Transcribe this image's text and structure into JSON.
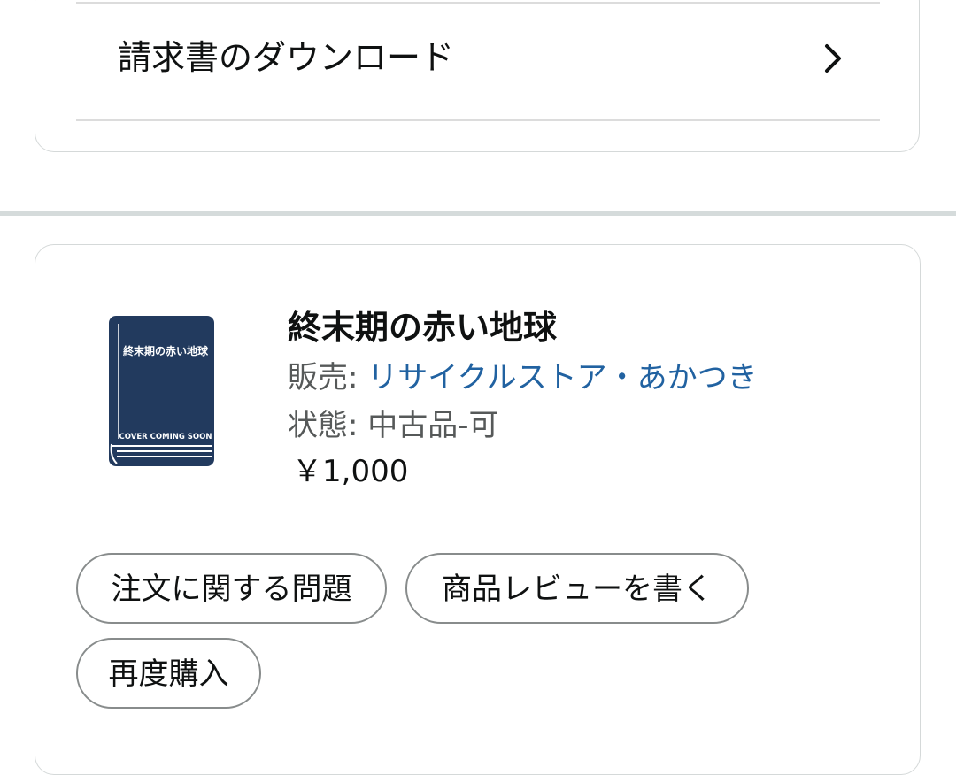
{
  "invoice": {
    "label": "請求書のダウンロード",
    "icon": "chevron-right-icon"
  },
  "product": {
    "cover": {
      "title": "終末期の赤い地球",
      "caption": "COVER COMING SOON",
      "color": "#223a5e"
    },
    "title": "終末期の赤い地球",
    "seller_label": "販売: ",
    "seller_name": "リサイクルストア・あかつき",
    "condition_label": "状態: ",
    "condition_value": "中古品-可",
    "price": "￥1,000"
  },
  "actions": {
    "problem": "注文に関する問題",
    "review": "商品レビューを書く",
    "rebuy": "再度購入"
  },
  "colors": {
    "link": "#2162a1",
    "border": "#d5d9d9",
    "divider": "#d5dbdb",
    "muted_text": "#565959"
  }
}
